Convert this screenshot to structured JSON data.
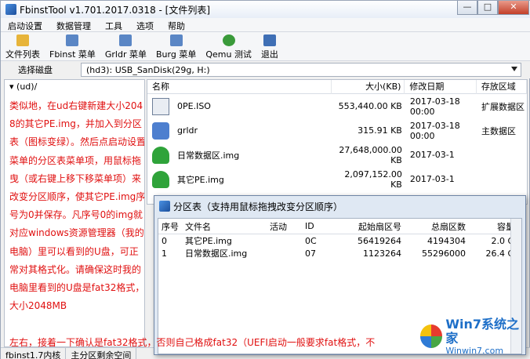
{
  "window": {
    "title": "FbinstTool v1.701.2017.0318 - [文件列表]",
    "buttons": [
      "—",
      "□",
      "✕"
    ]
  },
  "menu": [
    "启动设置",
    "数据管理",
    "工具",
    "选项",
    "帮助"
  ],
  "toolbar": [
    {
      "label": "文件列表",
      "icon": "folder-icon",
      "color": "#e7b43a"
    },
    {
      "label": "Fbinst 菜单",
      "icon": "menu-doc-icon",
      "color": "#5a86c5"
    },
    {
      "label": "Grldr 菜单",
      "icon": "menu-doc-icon",
      "color": "#5a86c5"
    },
    {
      "label": "Burg 菜单",
      "icon": "menu-doc-icon",
      "color": "#5a86c5"
    },
    {
      "label": "Qemu 测试",
      "icon": "qemu-icon",
      "color": "#3a9a3a"
    },
    {
      "label": "退出",
      "icon": "exit-icon",
      "color": "#3f6fb5"
    }
  ],
  "drive": {
    "label": "选择磁盘",
    "value": "(hd3): USB_SanDisk(29g, H:)"
  },
  "tree": {
    "root": "(ud)/",
    "note": "类似地，在ud右键新建大小2048的其它PE.img，并加入到分区表（图标变绿）。然后点启动设置菜单的分区表菜单项，用鼠标拖曳（或右键上移下移菜单项）来改变分区顺序，使其它PE.img序号为0并保存。凡序号0的img就对应windows资源管理器（我的电脑）里可以看到的U盘，可正常对其格式化。请确保这时我的电脑里看到的U盘是fat32格式，大小2048MB"
  },
  "filelist": {
    "headers": [
      "名称",
      "大小(KB)",
      "修改日期",
      "存放区域"
    ],
    "rows": [
      {
        "name": "0PE.ISO",
        "size": "553,440.00 KB",
        "date": "2017-03-18 00:00",
        "area": "扩展数据区",
        "icon": "iso-file-icon",
        "iconColor": "#6e7f99"
      },
      {
        "name": "grldr",
        "size": "315.91 KB",
        "date": "2017-03-18 00:00",
        "area": "主数据区",
        "icon": "grldr-file-icon",
        "iconColor": "#4d7fcf"
      },
      {
        "name": "日常数据区.img",
        "size": "27,648,000.00 KB",
        "date": "2017-03-1",
        "area": "",
        "icon": "disk-image-icon",
        "iconColor": "#2fa33a"
      },
      {
        "name": "其它PE.img",
        "size": "2,097,152.00 KB",
        "date": "2017-03-1",
        "area": "",
        "icon": "disk-image-icon",
        "iconColor": "#2fa33a"
      }
    ]
  },
  "dialog": {
    "title": "分区表（支持用鼠标拖拽改变分区顺序）",
    "headers": [
      "序号",
      "文件名",
      "活动",
      "ID",
      "起始扇区号",
      "总扇区数",
      "容量"
    ],
    "rows": [
      {
        "no": "0",
        "name": "其它PE.img",
        "active": "",
        "id": "0C",
        "start": "56419264",
        "total": "4194304",
        "cap": "2.0 G"
      },
      {
        "no": "1",
        "name": "日常数据区.img",
        "active": "",
        "id": "07",
        "start": "1123264",
        "total": "55296000",
        "cap": "26.4 G"
      }
    ]
  },
  "bottom_note": "左右，接着一下确认是fat32格式，否则自己格成fat32（UEFI启动一般要求fat格式，不",
  "statusbar": [
    "fbinst1.7内核",
    "主分区剩余空间"
  ],
  "logo": {
    "line1": "Win7系统之家",
    "line2": "Winwin7.com"
  }
}
